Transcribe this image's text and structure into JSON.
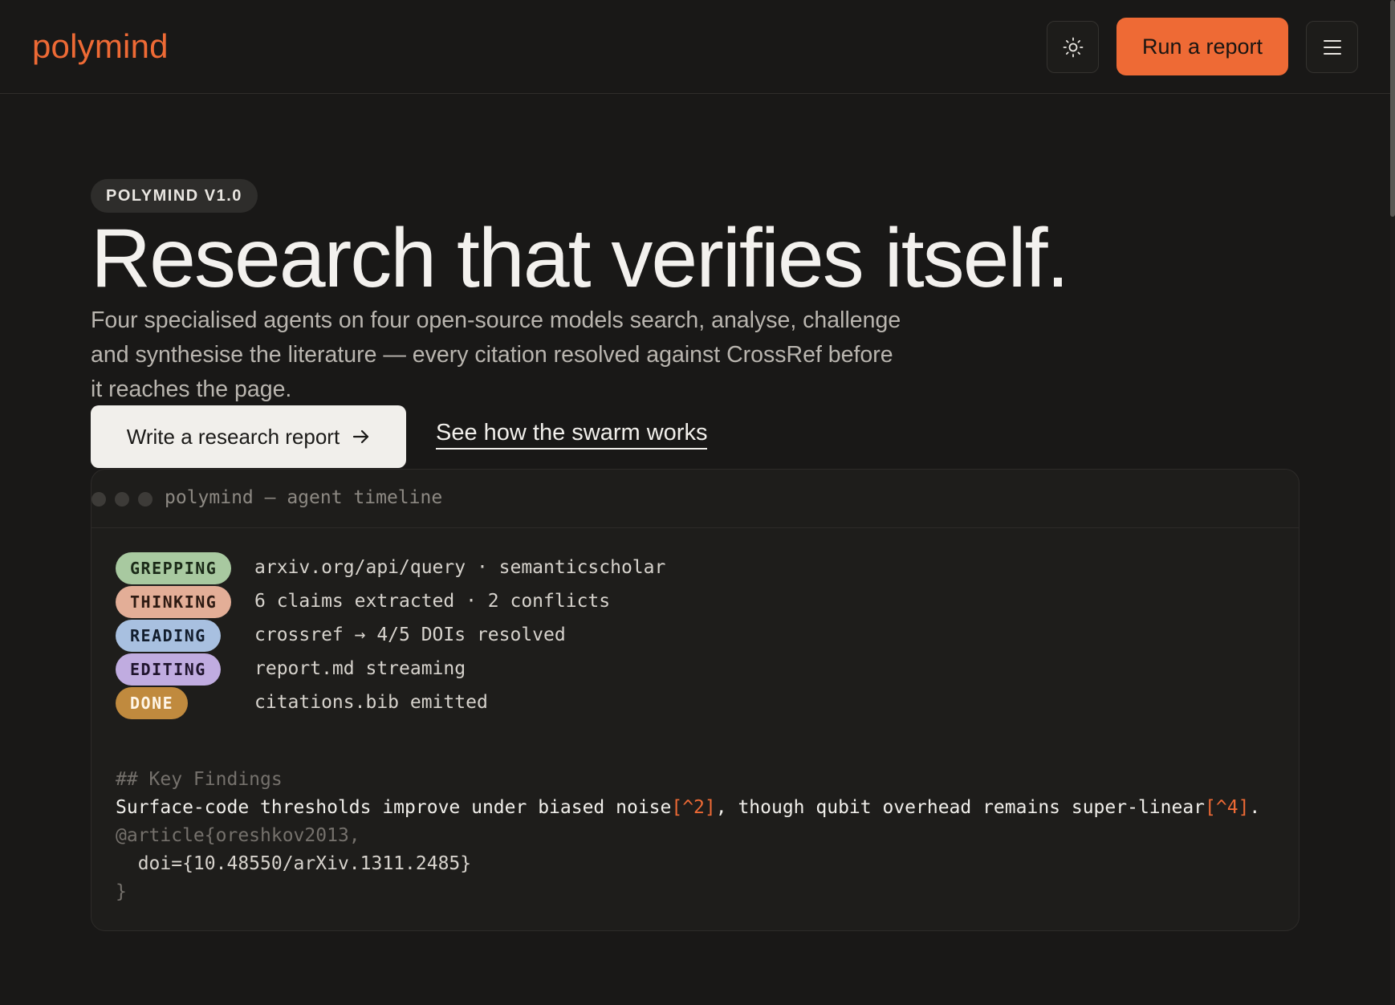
{
  "header": {
    "brand": "polymind",
    "theme_icon": "sun-icon",
    "run_label": "Run a report",
    "menu_icon": "hamburger-menu-icon"
  },
  "hero": {
    "version": "POLYMIND V1.0",
    "headline": "Research that verifies itself.",
    "subtext": "Four specialised agents on four open-source models search, analyse, challenge and synthesise the literature — every citation resolved against CrossRef before it reaches the page.",
    "primary_cta": "Write a research report",
    "primary_cta_icon": "arrow-right-icon",
    "secondary_cta": "See how the swarm works"
  },
  "terminal": {
    "title": "polymind — agent timeline",
    "rows": [
      {
        "status": "GREPPING",
        "color": "#a8c9a0",
        "text": "arxiv.org/api/query · semanticscholar"
      },
      {
        "status": "THINKING",
        "color": "#e3ae97",
        "text": "6 claims extracted · 2 conflicts"
      },
      {
        "status": "READING",
        "color": "#a8c0e0",
        "text": "crossref → 4/5 DOIs resolved"
      },
      {
        "status": "EDITING",
        "color": "#c0ace0",
        "text": "report.md streaming"
      },
      {
        "status": "DONE",
        "color": "#c08a3e",
        "text": "citations.bib emitted"
      }
    ],
    "code": {
      "heading": "## Key Findings",
      "finding_part1": "Surface-code thresholds improve under biased noise",
      "footnote1": "[^2]",
      "finding_part2": ", though qubit overhead remains super-linear",
      "footnote2": "[^4]",
      "finding_end": ".",
      "bib_open": "@article{oreshkov2013,",
      "bib_doi": "  doi={10.48550/arXiv.1311.2485}",
      "bib_close": "}"
    }
  },
  "colors": {
    "accent": "#ee6a35",
    "background": "#191817"
  }
}
